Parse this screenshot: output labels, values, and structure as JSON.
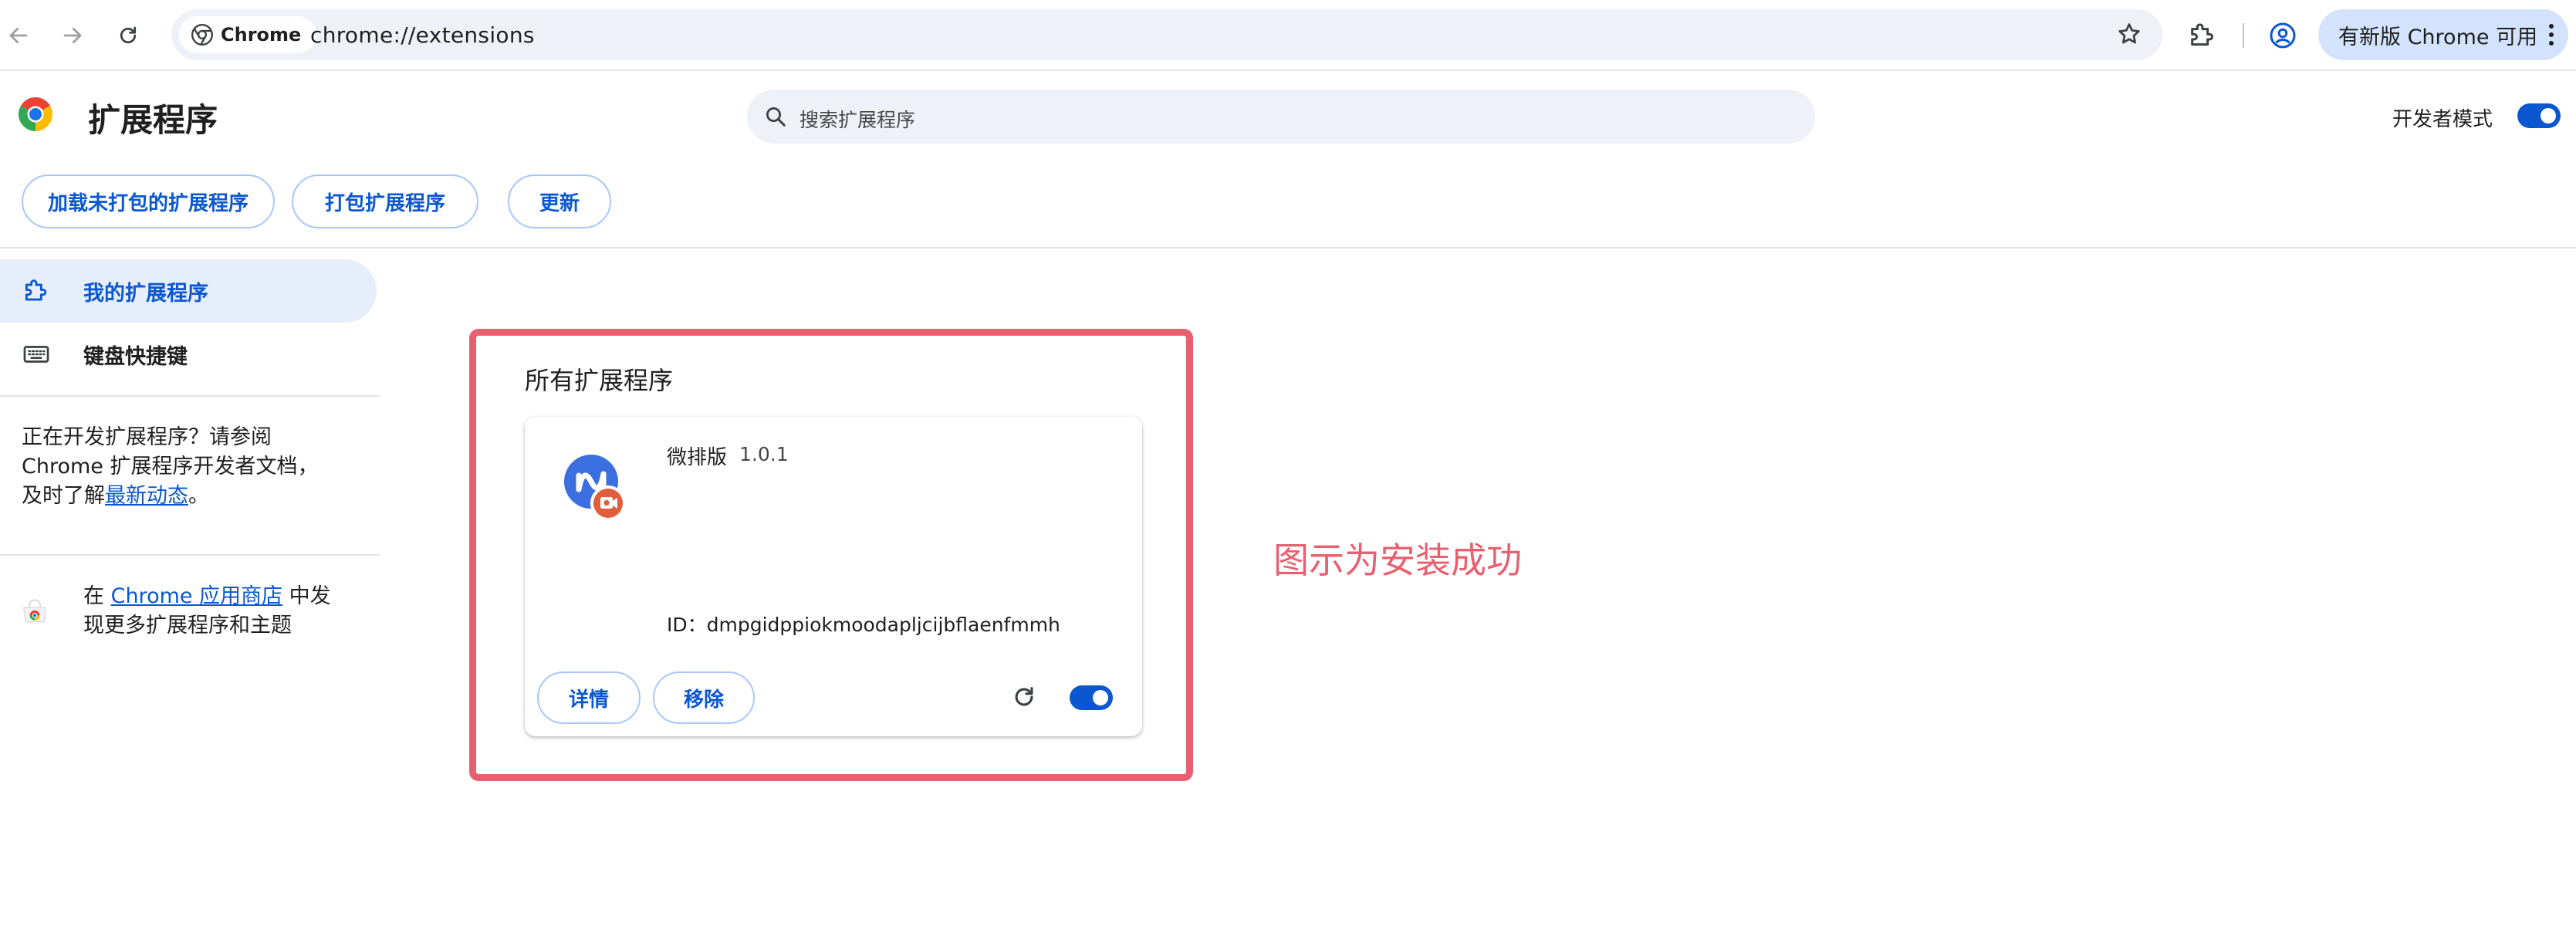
{
  "browser": {
    "chip_label": "Chrome",
    "url": "chrome://extensions",
    "update_label": "有新版 Chrome 可用"
  },
  "header": {
    "title": "扩展程序",
    "search_placeholder": "搜索扩展程序",
    "dev_mode_label": "开发者模式",
    "dev_mode_on": true
  },
  "actions": {
    "load_unpacked": "加载未打包的扩展程序",
    "pack": "打包扩展程序",
    "update": "更新"
  },
  "sidebar": {
    "items": [
      {
        "label": "我的扩展程序",
        "selected": true
      },
      {
        "label": "键盘快捷键",
        "selected": false
      }
    ],
    "dev_note_prefix": "正在开发扩展程序？请参阅 Chrome 扩展程序开发者文档，及时了解",
    "dev_note_link": "最新动态",
    "dev_note_suffix": "。",
    "store_prefix": "在 ",
    "store_link": "Chrome 应用商店",
    "store_suffix": " 中发现更多扩展程序和主题"
  },
  "main": {
    "section_title": "所有扩展程序",
    "extension": {
      "name": "微排版",
      "version": "1.0.1",
      "id_text": "ID：dmpgidppiokmoodapljcijbflaenfmmh",
      "details_label": "详情",
      "remove_label": "移除",
      "enabled": true
    },
    "annotation": "图示为安装成功"
  },
  "colors": {
    "accent": "#0b57d0",
    "highlight": "#e8606f",
    "selected_bg": "#e7eefb"
  }
}
